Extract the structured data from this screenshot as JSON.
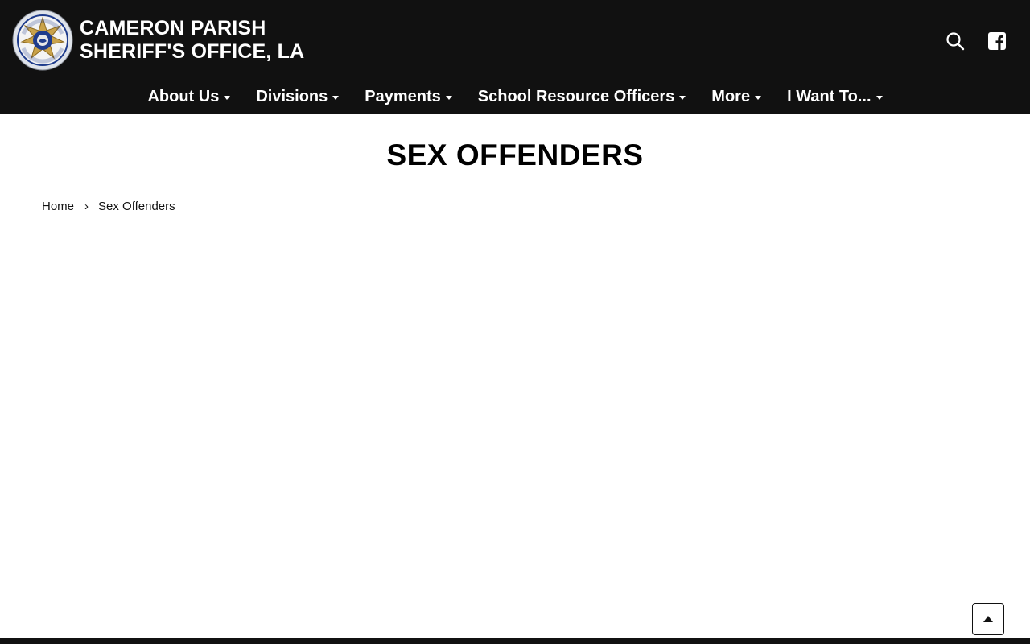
{
  "site": {
    "title_line1": "CAMERON PARISH",
    "title_line2": "SHERIFF'S OFFICE, LA",
    "logo_icon": "sheriff-badge-logo"
  },
  "header_icons": {
    "search": "search-icon",
    "facebook": "facebook-icon"
  },
  "nav": {
    "items": [
      {
        "label": "About Us"
      },
      {
        "label": "Divisions"
      },
      {
        "label": "Payments"
      },
      {
        "label": "School Resource Officers"
      },
      {
        "label": "More"
      },
      {
        "label": "I Want To..."
      }
    ]
  },
  "page": {
    "title": "SEX OFFENDERS"
  },
  "breadcrumb": {
    "home": "Home",
    "separator": "›",
    "current": "Sex Offenders"
  },
  "back_to_top": {
    "icon": "arrow-up-icon"
  },
  "colors": {
    "header_bg": "#111111",
    "text_on_dark": "#ffffff",
    "text": "#000000",
    "badge_gold": "#c9a24a",
    "badge_blue": "#1f3c8c"
  }
}
